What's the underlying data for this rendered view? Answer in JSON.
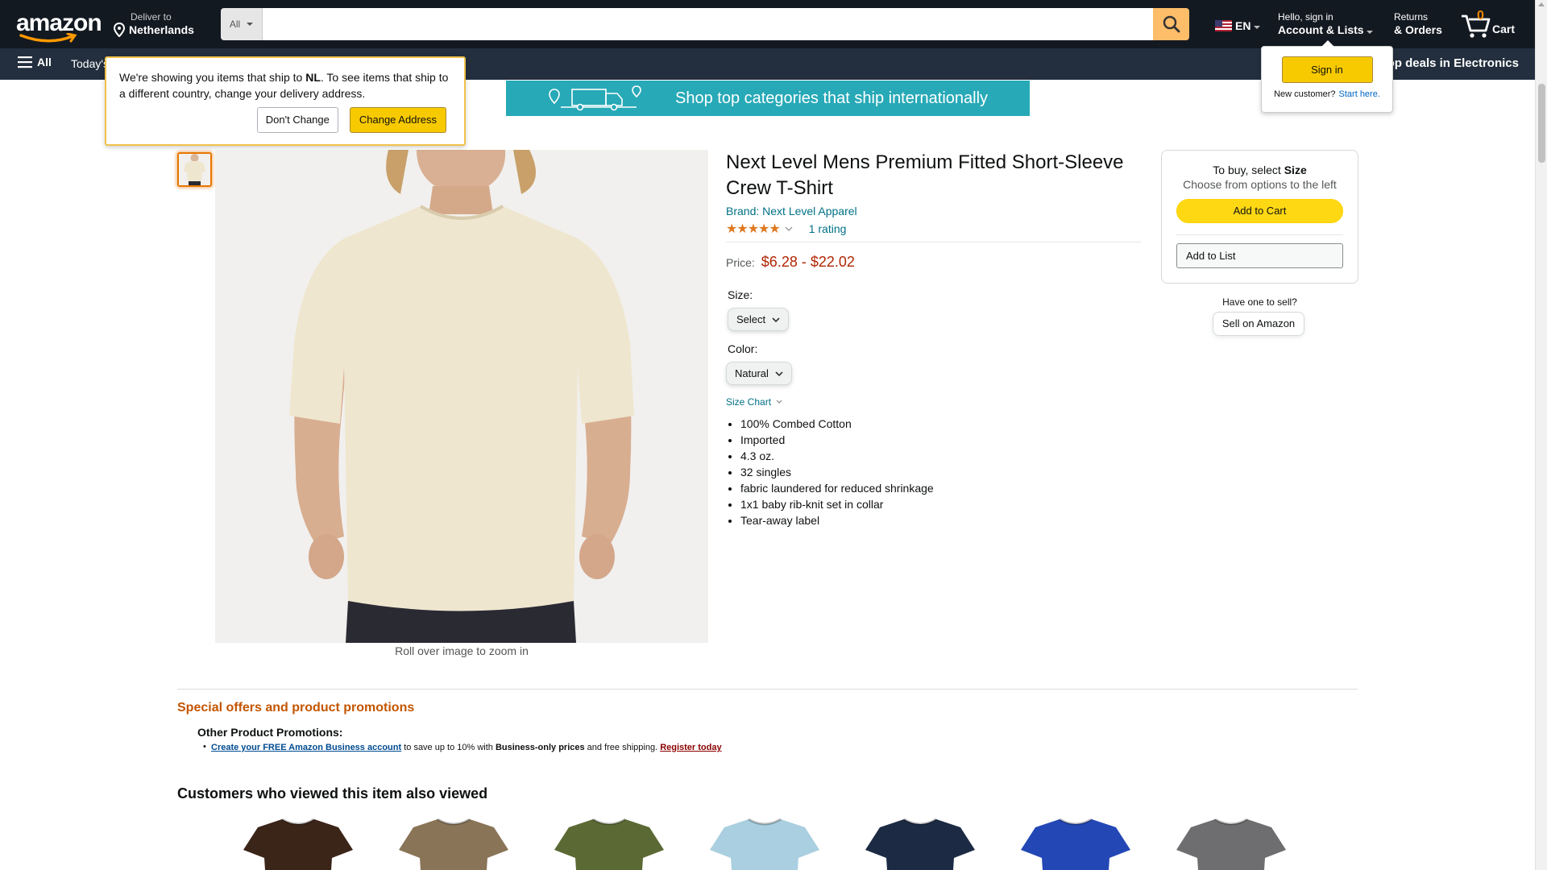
{
  "nav": {
    "logo": "amazon",
    "deliver_line1": "Deliver to",
    "deliver_line2": "Netherlands",
    "search_category": "All",
    "search_placeholder": "",
    "language": "EN",
    "account_line1": "Hello, sign in",
    "account_line2": "Account & Lists",
    "returns_line1": "Returns",
    "returns_line2": "& Orders",
    "cart_count": "0",
    "cart_label": "Cart",
    "all_label": "All",
    "subnav_item": "Today's",
    "subnav_right": "Shop deals in Electronics"
  },
  "ship_popover": {
    "text_before": "We're showing you items that ship to ",
    "country": "NL",
    "text_after": ". To see items that ship to a different country, change your delivery address.",
    "dont_change": "Don't Change",
    "change_address": "Change Address"
  },
  "signin_popover": {
    "button": "Sign in",
    "new_customer": "New customer?",
    "start_here": "Start here."
  },
  "banner": {
    "text": "Shop top categories that ship internationally",
    "color": "#27a9b7"
  },
  "product": {
    "title": "Next Level Mens Premium Fitted Short-Sleeve Crew T-Shirt",
    "brand": "Brand: Next Level Apparel",
    "stars": "★★★★★",
    "rating_value": 5,
    "rating_count": "1 rating",
    "price_label": "Price:",
    "price_range": "$6.28 - $22.02",
    "size_label": "Size:",
    "size_value": "Select",
    "color_label": "Color:",
    "color_value": "Natural",
    "size_chart": "Size Chart",
    "bullets": [
      "100% Combed Cotton",
      "Imported",
      "4.3 oz.",
      "32 singles",
      "fabric laundered for reduced shrinkage",
      "1x1 baby rib-knit set in collar",
      "Tear-away label"
    ],
    "zoom_hint": "Roll over image to zoom in"
  },
  "buybox": {
    "to_buy_prefix": "To buy, select ",
    "to_buy_bold": "Size",
    "choose": "Choose from options to the left",
    "add_to_cart": "Add to Cart",
    "add_to_list": "Add to List",
    "have_one": "Have one to sell?",
    "sell": "Sell on Amazon"
  },
  "promos": {
    "heading": "Special offers and product promotions",
    "sub": "Other Product Promotions:",
    "link1": "Create your FREE Amazon Business account",
    "mid1": " to save up to 10% with ",
    "bold": "Business-only prices",
    "mid2": " and free shipping. ",
    "link2": "Register today"
  },
  "also_viewed": {
    "heading": "Customers who viewed this item also viewed",
    "shirt_colors": [
      "#3b2418",
      "#8a7457",
      "#5b6a34",
      "#a9cfe0",
      "#1c2a44",
      "#2347b5",
      "#6e6e70"
    ]
  }
}
